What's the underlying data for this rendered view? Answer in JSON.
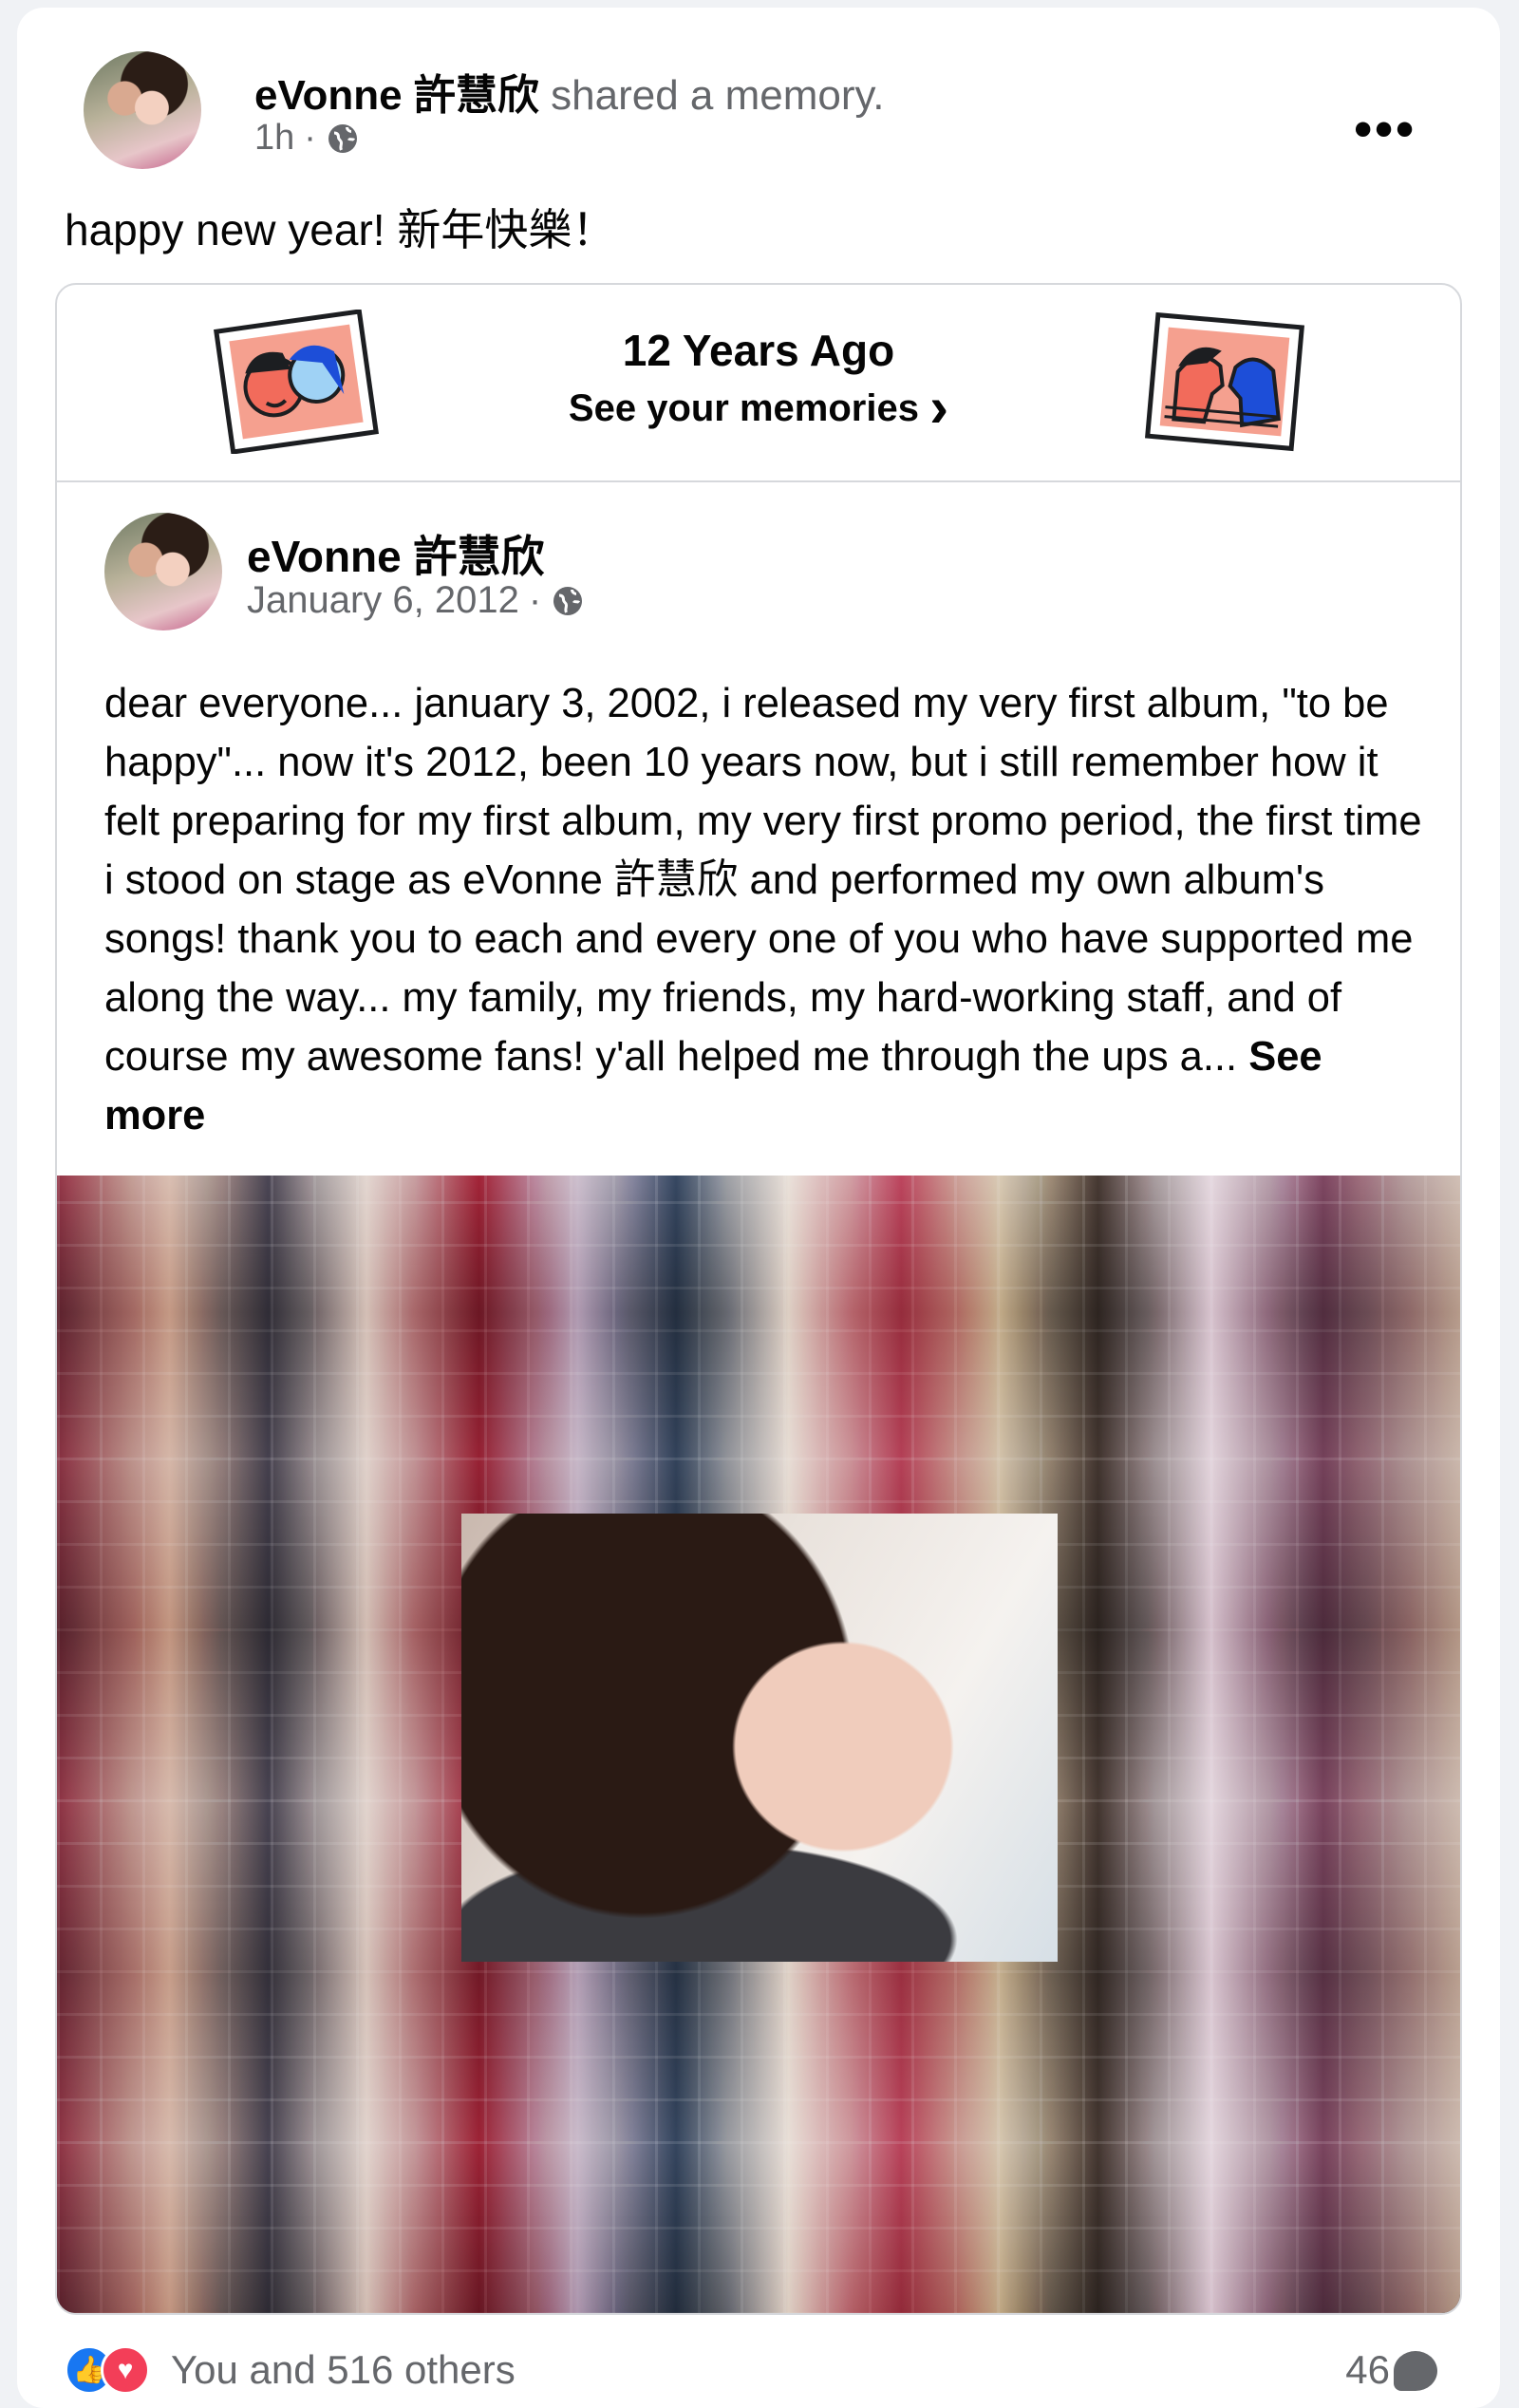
{
  "post": {
    "author": "eVonne 許慧欣",
    "action": "shared a memory.",
    "time": "1h",
    "separator": "·",
    "privacy_icon": "globe-icon",
    "more_icon": "•••",
    "caption": "happy new year! 新年快樂！"
  },
  "memory": {
    "title": "12 Years Ago",
    "subtitle": "See your memories",
    "chevron": "›",
    "original": {
      "author": "eVonne 許慧欣",
      "date": "January 6, 2012",
      "separator": "·",
      "text": "dear everyone... january 3, 2002, i released my very first album, \"to be happy\"... now it's 2012, been 10 years now, but i still remember how it felt preparing for my first album, my very first promo period, the first time i stood on stage as eVonne 許慧欣 and performed my own album's songs!  thank you to each and every one of you who have supported me along the way... my family, my friends, my hard-working staff, and of course my awesome fans!  y'all helped me through the ups a...",
      "see_more": "See more"
    }
  },
  "footer": {
    "reactions_text": "You and 516 others",
    "like_icon": "👍",
    "love_icon": "♥",
    "comment_count": "46"
  },
  "colors": {
    "link_blue": "#1877f2",
    "love_red": "#f33e58",
    "secondary_text": "#65676b"
  }
}
